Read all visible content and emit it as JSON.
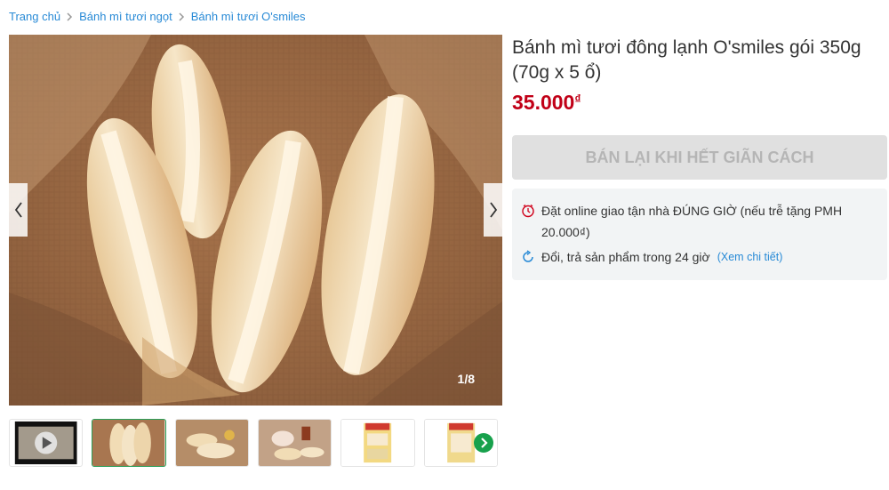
{
  "breadcrumb": {
    "items": [
      "Trang chủ",
      "Bánh mì tươi ngọt",
      "Bánh mì tươi O'smiles"
    ]
  },
  "product": {
    "title": "Bánh mì tươi đông lạnh O'smiles gói 350g (70g x 5 ổ)",
    "price": "35.000",
    "currency": "₫",
    "sold_out_button": "BÁN LẠI KHI HẾT GIÃN CÁCH"
  },
  "gallery": {
    "counter": "1/8",
    "thumbnail_count": 6,
    "active_thumbnail": 2
  },
  "policy": {
    "delivery_line1": "Đặt online giao tận nhà ĐÚNG GIỜ (nếu trễ tặng PMH",
    "delivery_line2": "20.000₫)",
    "return_text": "Đổi, trả sản phẩm trong 24 giờ",
    "return_link": "(Xem chi tiết)"
  },
  "icons": {
    "breadcrumb_separator": "chevron-right-icon",
    "gallery_prev": "chevron-left-icon",
    "gallery_next": "chevron-right-icon",
    "thumbnails_next": "arrow-right-circle-icon",
    "delivery": "clock-icon",
    "return": "refresh-icon",
    "video": "play-icon"
  },
  "colors": {
    "link": "#288ad6",
    "price": "#c10017",
    "disabled_button_bg": "#e0e0e0",
    "disabled_button_text": "#b5b5b5",
    "active_border": "#2aa05a",
    "next_circle": "#17a14c"
  }
}
